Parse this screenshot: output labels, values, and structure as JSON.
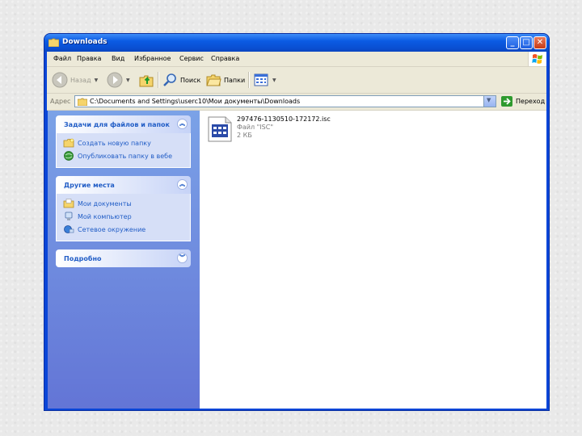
{
  "window": {
    "title": "Downloads"
  },
  "menu": {
    "items": [
      "Файл",
      "Правка",
      "Вид",
      "Избранное",
      "Сервис",
      "Справка"
    ]
  },
  "toolbar": {
    "back_label": "Назад",
    "search_label": "Поиск",
    "folders_label": "Папки"
  },
  "address": {
    "label": "Адрес",
    "path": "C:\\Documents and Settings\\userc10\\Мои документы\\Downloads",
    "go_label": "Переход"
  },
  "tasks_panel": {
    "title": "Задачи для файлов и папок",
    "items": [
      {
        "label": "Создать новую папку",
        "icon": "new-folder-icon"
      },
      {
        "label": "Опубликовать папку в вебе",
        "icon": "publish-web-icon"
      }
    ]
  },
  "places_panel": {
    "title": "Другие места",
    "items": [
      {
        "label": "Мои документы",
        "icon": "my-documents-icon"
      },
      {
        "label": "Мой компьютер",
        "icon": "my-computer-icon"
      },
      {
        "label": "Сетевое окружение",
        "icon": "network-icon"
      }
    ]
  },
  "details_panel": {
    "title": "Подробно"
  },
  "files": [
    {
      "name": "297476-1130510-172172.isc",
      "type": "Файл \"ISC\"",
      "size": "2 КБ"
    }
  ],
  "colors": {
    "title_bar": "#0b5be3",
    "left_pane_top": "#7ba2e7",
    "left_pane_bottom": "#6375d6",
    "link": "#215dc6"
  }
}
